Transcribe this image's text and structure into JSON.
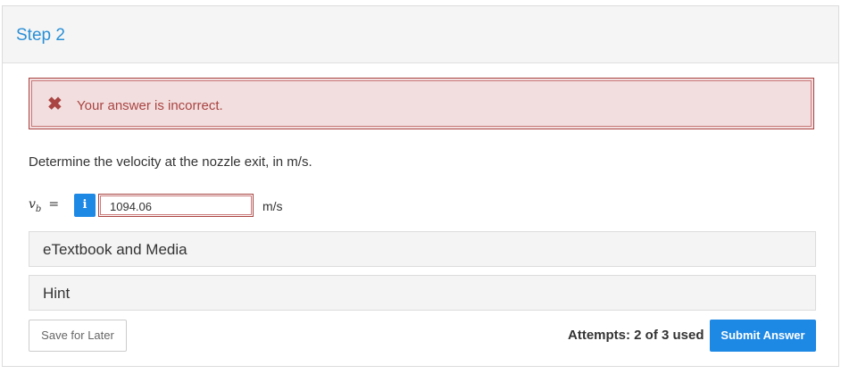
{
  "step": {
    "title": "Step 2"
  },
  "alert": {
    "icon": "close-icon",
    "message": "Your answer is incorrect."
  },
  "question": {
    "prompt": "Determine the velocity at the nozzle exit, in m/s.",
    "variable": "v",
    "subscript": "b",
    "equals": "=",
    "info_label": "i",
    "answer_value": "1094.06",
    "unit": "m/s"
  },
  "resources": {
    "etextbook_label": "eTextbook and Media",
    "hint_label": "Hint"
  },
  "footer": {
    "save_label": "Save for Later",
    "attempts_text": "Attempts: 2 of 3 used",
    "submit_label": "Submit Answer"
  },
  "colors": {
    "accent": "#1e88e5",
    "title": "#2a8fd6",
    "error_bg": "#f2dede",
    "error_text": "#a94442"
  }
}
